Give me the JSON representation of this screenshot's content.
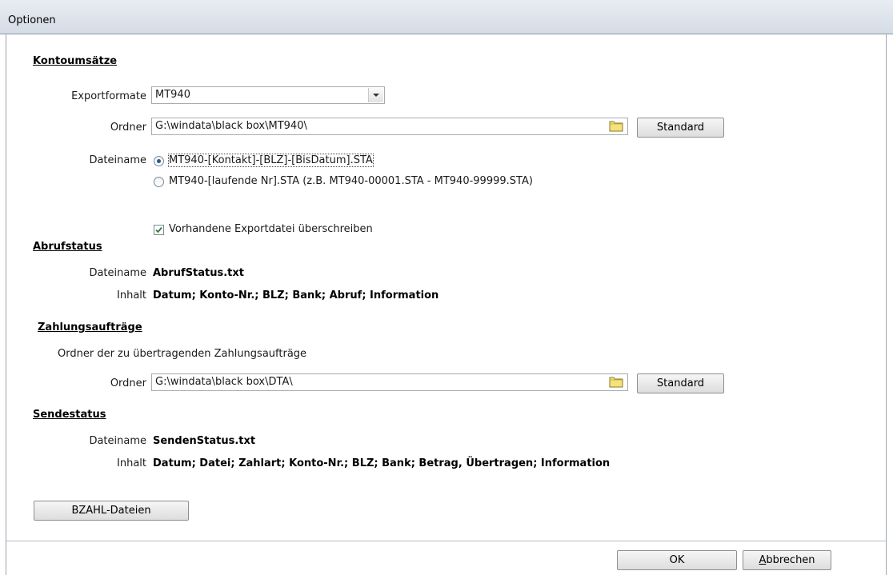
{
  "window": {
    "title": "Optionen"
  },
  "kontoumsaetze": {
    "heading": "Kontoumsätze",
    "exportformate_label": "Exportformate",
    "exportformate_value": "MT940",
    "ordner_label": "Ordner",
    "ordner_value": "G:\\windata\\black box\\MT940\\",
    "standard_label": "Standard",
    "dateiname_label": "Dateiname",
    "radio1_label": "MT940-[Kontakt]-[BLZ]-[BisDatum].STA",
    "radio2_label": "MT940-[laufende Nr].STA (z.B. MT940-00001.STA - MT940-99999.STA)",
    "overwrite_label": "Vorhandene Exportdatei überschreiben",
    "radio_selected": 1,
    "overwrite_checked": true
  },
  "abrufstatus": {
    "heading": "Abrufstatus",
    "dateiname_label": "Dateiname",
    "dateiname_value": "AbrufStatus.txt",
    "inhalt_label": "Inhalt",
    "inhalt_value": "Datum; Konto-Nr.; BLZ; Bank; Abruf; Information"
  },
  "zahlungsauftraege": {
    "heading": "Zahlungsaufträge",
    "description": "Ordner der zu übertragenden Zahlungsaufträge",
    "ordner_label": "Ordner",
    "ordner_value": "G:\\windata\\black box\\DTA\\",
    "standard_label": "Standard"
  },
  "sendestatus": {
    "heading": "Sendestatus",
    "dateiname_label": "Dateiname",
    "dateiname_value": "SendenStatus.txt",
    "inhalt_label": "Inhalt",
    "inhalt_value": "Datum; Datei; Zahlart; Konto-Nr.; BLZ; Bank; Betrag, Übertragen; Information"
  },
  "buttons": {
    "bzahl_label": "BZAHL-Dateien",
    "ok_label": "OK",
    "cancel_label": "Abbrechen"
  }
}
